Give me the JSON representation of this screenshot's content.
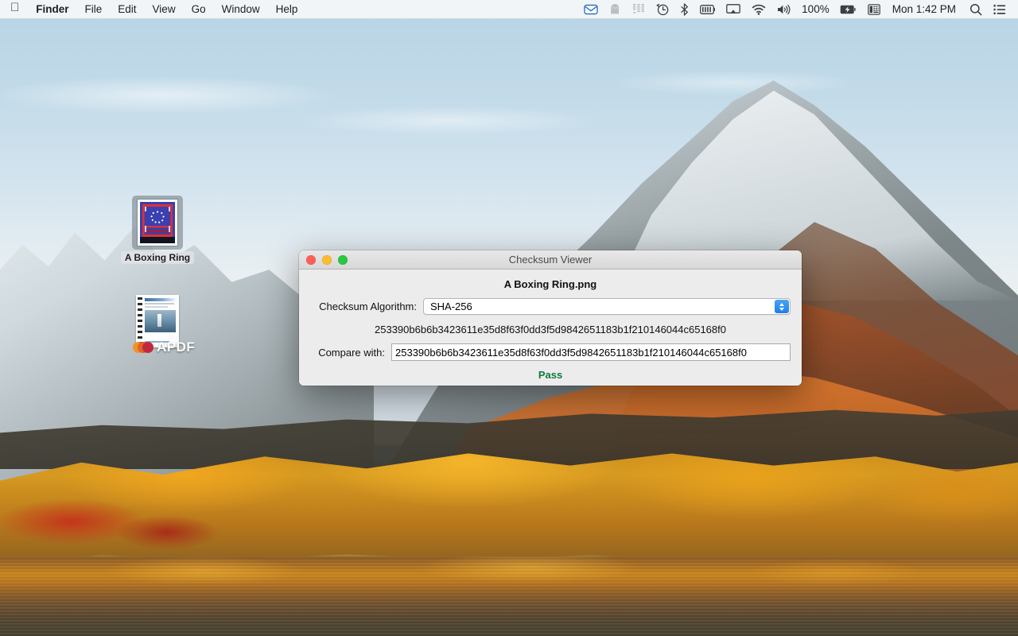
{
  "menubar": {
    "apple_icon": "apple-logo-icon",
    "items": [
      {
        "label": "Finder",
        "bold": true
      },
      {
        "label": "File",
        "bold": false
      },
      {
        "label": "Edit",
        "bold": false
      },
      {
        "label": "View",
        "bold": false
      },
      {
        "label": "Go",
        "bold": false
      },
      {
        "label": "Window",
        "bold": false
      },
      {
        "label": "Help",
        "bold": false
      }
    ],
    "status_icons": [
      "mail-envelope-icon",
      "ghost-icon",
      "equalizer-sliders-icon",
      "time-machine-clock-icon",
      "bluetooth-icon",
      "battery-cells-icon",
      "airplay-screen-icon",
      "wifi-icon",
      "volume-speaker-icon"
    ],
    "battery_percent": "100%",
    "battery_charging_icon": "battery-charging-icon",
    "keyboard_input_icon": "input-source-keyboard-icon",
    "clock": "Mon 1:42 PM",
    "search_icon": "spotlight-search-icon",
    "notification_icon": "notification-center-icon"
  },
  "desktop": {
    "icons": [
      {
        "name": "A Boxing Ring",
        "label": "A Boxing Ring",
        "type": "image-file",
        "selected": true
      },
      {
        "name": "APDF",
        "label": "APDF",
        "type": "pdf-document",
        "selected": false
      }
    ]
  },
  "window": {
    "title": "Checksum Viewer",
    "traffic_lights": {
      "close": "close-button",
      "minimize": "minimize-button",
      "zoom": "zoom-button"
    },
    "filename": "A Boxing Ring.png",
    "algorithm_label": "Checksum Algorithm:",
    "algorithm_value": "SHA-256",
    "algorithm_options": [
      "SHA-256"
    ],
    "computed_checksum": "253390b6b6b3423611e35d8f63f0dd3f5d9842651183b1f210146044c65168f0",
    "compare_label": "Compare with:",
    "compare_value": "253390b6b6b3423611e35d8f63f0dd3f5d9842651183b1f210146044c65168f0",
    "compare_placeholder": "",
    "status_text": "Pass",
    "status_color": "#0f7a3d"
  }
}
